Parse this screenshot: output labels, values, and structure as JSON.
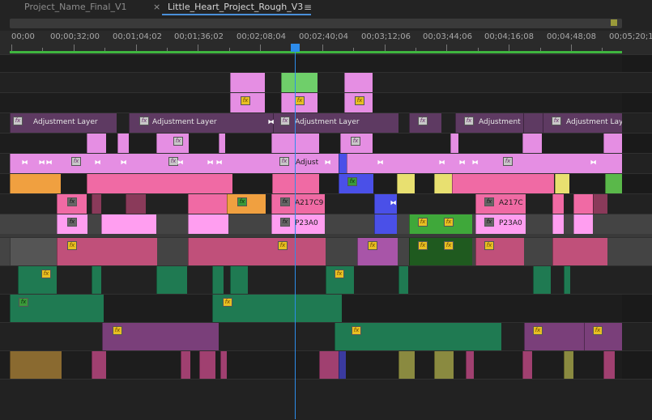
{
  "tabs": [
    {
      "label": "Project_Name_Final_V1",
      "active": false
    },
    {
      "label": "Little_Heart_Project_Rough_V3",
      "active": true
    }
  ],
  "tab_close_glyph": "×",
  "tab_menu_glyph": "≡",
  "timecodes": [
    "00;00",
    "00;00;32;00",
    "00;01;04;02",
    "00;01;36;02",
    "00;02;08;04",
    "00;02;40;04",
    "00;03;12;06",
    "00;03;44;06",
    "00;04;16;08",
    "00;04;48;08",
    "00;05;20;10"
  ],
  "colors": {
    "playhead": "#2d8ceb",
    "work_area": "#3fb53f"
  },
  "labels": {
    "adjustment_layer": "Adjustment Layer",
    "adjustment_short": "Adjustment",
    "adjustment_lay": "Adjustment Lay",
    "adjust": "Adjust",
    "a217c9": "A217C9",
    "a217c": "A217C",
    "p23a0": "P23A0",
    "fx": "fx",
    "transition": "⧓"
  }
}
